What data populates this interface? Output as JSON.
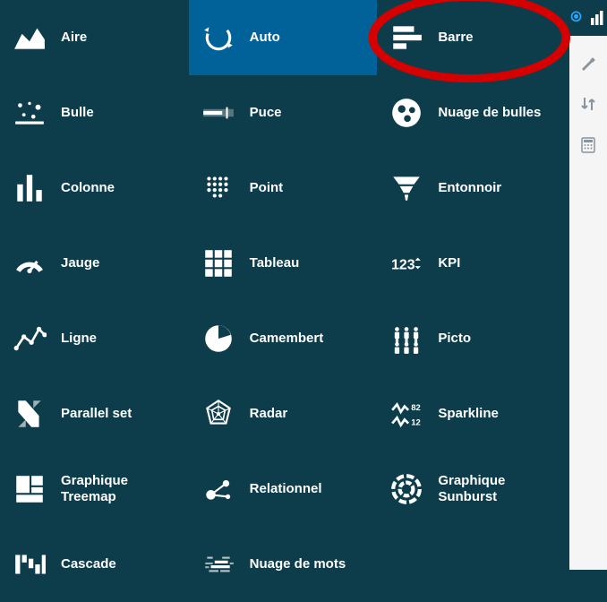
{
  "chartTypes": [
    {
      "id": "aire",
      "label": "Aire",
      "icon": "area-icon",
      "selected": false,
      "highlighted": false
    },
    {
      "id": "auto",
      "label": "Auto",
      "icon": "auto-icon",
      "selected": true,
      "highlighted": false
    },
    {
      "id": "barre",
      "label": "Barre",
      "icon": "bar-icon",
      "selected": false,
      "highlighted": true
    },
    {
      "id": "bulle",
      "label": "Bulle",
      "icon": "bubble-icon",
      "selected": false,
      "highlighted": false
    },
    {
      "id": "puce",
      "label": "Puce",
      "icon": "bullet-icon",
      "selected": false,
      "highlighted": false
    },
    {
      "id": "nuage-bulles",
      "label": "Nuage de bulles",
      "icon": "packed-bubble-icon",
      "selected": false,
      "highlighted": false
    },
    {
      "id": "colonne",
      "label": "Colonne",
      "icon": "column-icon",
      "selected": false,
      "highlighted": false
    },
    {
      "id": "point",
      "label": "Point",
      "icon": "dot-icon",
      "selected": false,
      "highlighted": false
    },
    {
      "id": "entonnoir",
      "label": "Entonnoir",
      "icon": "funnel-icon",
      "selected": false,
      "highlighted": false
    },
    {
      "id": "jauge",
      "label": "Jauge",
      "icon": "gauge-icon",
      "selected": false,
      "highlighted": false
    },
    {
      "id": "tableau",
      "label": "Tableau",
      "icon": "grid-icon",
      "selected": false,
      "highlighted": false
    },
    {
      "id": "kpi",
      "label": "KPI",
      "icon": "kpi-icon",
      "selected": false,
      "highlighted": false
    },
    {
      "id": "ligne",
      "label": "Ligne",
      "icon": "line-icon",
      "selected": false,
      "highlighted": false
    },
    {
      "id": "camembert",
      "label": "Camembert",
      "icon": "pie-icon",
      "selected": false,
      "highlighted": false
    },
    {
      "id": "picto",
      "label": "Picto",
      "icon": "picto-icon",
      "selected": false,
      "highlighted": false
    },
    {
      "id": "parallel-set",
      "label": "Parallel set",
      "icon": "parallel-set-icon",
      "selected": false,
      "highlighted": false
    },
    {
      "id": "radar",
      "label": "Radar",
      "icon": "radar-icon",
      "selected": false,
      "highlighted": false
    },
    {
      "id": "sparkline",
      "label": "Sparkline",
      "icon": "sparkline-icon",
      "selected": false,
      "highlighted": false
    },
    {
      "id": "treemap",
      "label": "Graphique Treemap",
      "icon": "treemap-icon",
      "selected": false,
      "highlighted": false
    },
    {
      "id": "relationnel",
      "label": "Relationnel",
      "icon": "relational-icon",
      "selected": false,
      "highlighted": false
    },
    {
      "id": "sunburst",
      "label": "Graphique Sunburst",
      "icon": "sunburst-icon",
      "selected": false,
      "highlighted": false
    },
    {
      "id": "cascade",
      "label": "Cascade",
      "icon": "waterfall-icon",
      "selected": false,
      "highlighted": false
    },
    {
      "id": "nuage-mots",
      "label": "Nuage de mots",
      "icon": "wordcloud-icon",
      "selected": false,
      "highlighted": false
    }
  ],
  "sideRail": {
    "active": "chart-rail-icon",
    "items": [
      {
        "id": "chart-rail-icon",
        "name": "chart-rail-icon"
      },
      {
        "id": "brush-rail-icon",
        "name": "brush-rail-icon"
      },
      {
        "id": "sort-rail-icon",
        "name": "sort-rail-icon"
      },
      {
        "id": "calculator-rail-icon",
        "name": "calculator-rail-icon"
      }
    ]
  },
  "colors": {
    "panel": "#0d3c4b",
    "selected": "#006298",
    "rail": "#f5f5f5",
    "highlight": "#d50000"
  }
}
